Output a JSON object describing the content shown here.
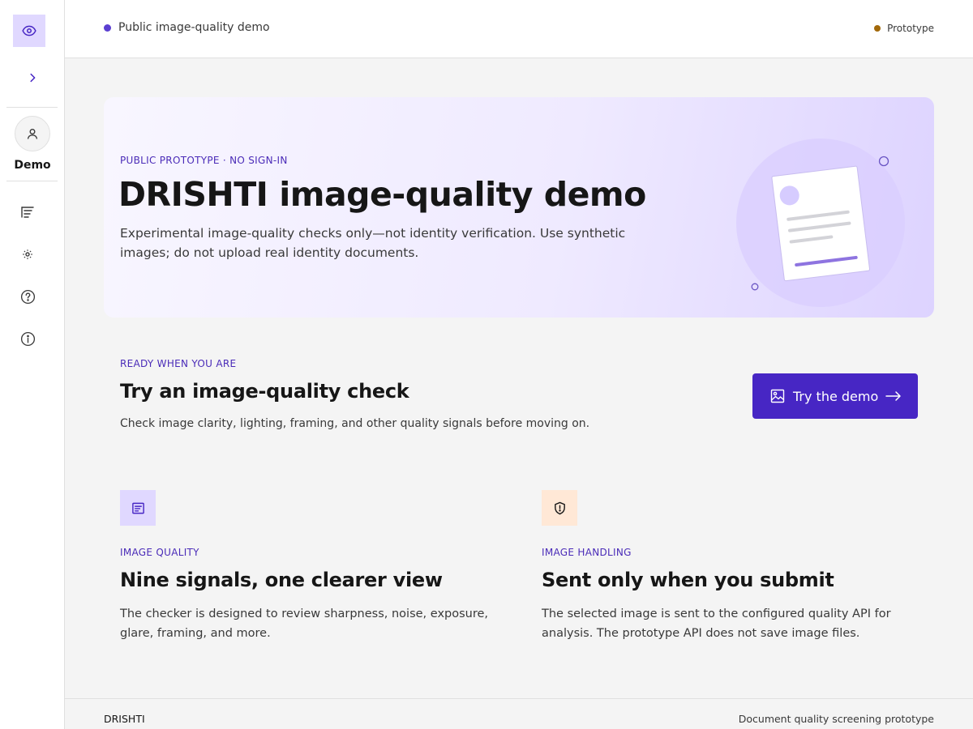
{
  "colors": {
    "accent": "#4726c4",
    "accent_light": "#e0d8ff",
    "status_dot_primary": "#5b3fd1",
    "status_dot_prototype": "#a2690a",
    "handling_icon_bg": "#ffe8d6"
  },
  "sidebar": {
    "logo_icon": "eye-icon",
    "expand_icon": "chevron-right-icon",
    "user_label": "Demo",
    "nav": [
      {
        "icon": "list-icon"
      },
      {
        "icon": "settings-icon"
      },
      {
        "icon": "help-icon"
      },
      {
        "icon": "info-icon"
      }
    ]
  },
  "topbar": {
    "title": "Public image-quality demo",
    "badge": "Prototype"
  },
  "hero": {
    "eyebrow": "PUBLIC PROTOTYPE · NO SIGN-IN",
    "title": "DRISHTI image-quality demo",
    "description": "Experimental image-quality checks only—not identity verification. Use synthetic images; do not upload real identity documents."
  },
  "cta": {
    "eyebrow": "READY WHEN YOU ARE",
    "title": "Try an image-quality check",
    "description": "Check image clarity, lighting, framing, and other quality signals before moving on.",
    "button_label": "Try the demo"
  },
  "features": [
    {
      "icon": "quality-report-icon",
      "eyebrow": "IMAGE QUALITY",
      "title": "Nine signals, one clearer view",
      "description": "The checker is designed to review sharpness, noise, exposure, glare, framing, and more."
    },
    {
      "icon": "shield-alert-icon",
      "eyebrow": "IMAGE HANDLING",
      "title": "Sent only when you submit",
      "description": "The selected image is sent to the configured quality API for analysis. The prototype API does not save image files."
    }
  ],
  "footer": {
    "brand": "DRISHTI",
    "tagline": "Document quality screening prototype"
  }
}
